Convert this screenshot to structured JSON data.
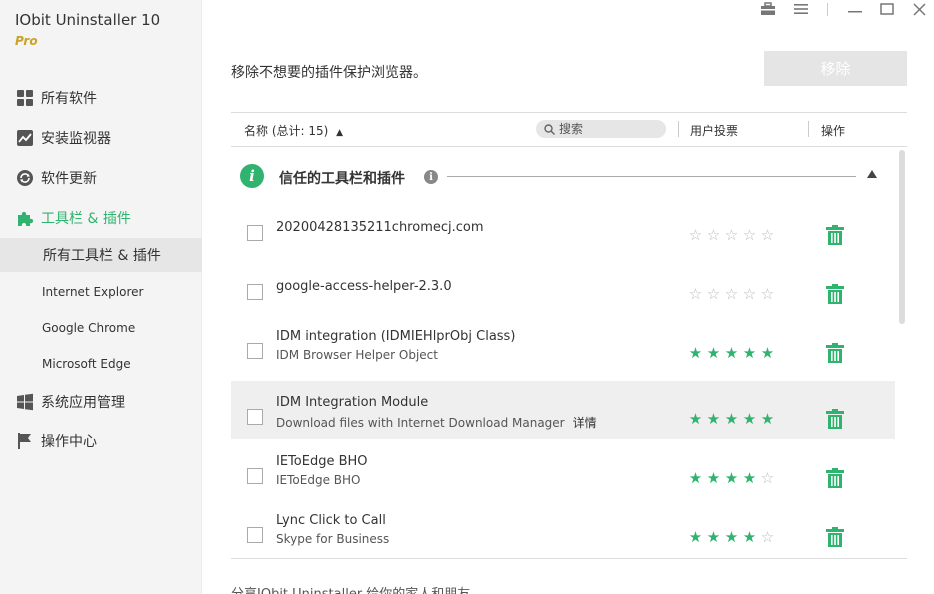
{
  "app": {
    "title": "IObit Uninstaller 10",
    "edition": "Pro"
  },
  "sidebar": {
    "items": [
      {
        "label": "所有软件",
        "icon": "grid-icon"
      },
      {
        "label": "安装监视器",
        "icon": "chart-icon"
      },
      {
        "label": "软件更新",
        "icon": "refresh-icon"
      },
      {
        "label": "工具栏 & 插件",
        "icon": "puzzle-icon",
        "active": true
      },
      {
        "label": "系统应用管理",
        "icon": "windows-icon"
      },
      {
        "label": "操作中心",
        "icon": "flag-icon"
      }
    ],
    "subitems": [
      {
        "label": "所有工具栏 & 插件",
        "selected": true
      },
      {
        "label": "Internet Explorer"
      },
      {
        "label": "Google Chrome"
      },
      {
        "label": "Microsoft Edge"
      }
    ]
  },
  "main": {
    "headline": "移除不想要的插件保护浏览器。",
    "remove_button": "移除",
    "columns": {
      "name": "名称 (总计: 15)",
      "search_placeholder": "搜索",
      "votes": "用户投票",
      "action": "操作"
    },
    "section": {
      "title": "信任的工具栏和插件",
      "icon_letter": "i"
    },
    "rows": [
      {
        "name": "20200428135211chromecj.com",
        "desc": "",
        "rating": 0
      },
      {
        "name": "google-access-helper-2.3.0",
        "desc": "",
        "rating": 0
      },
      {
        "name": "IDM integration (IDMIEHlprObj Class)",
        "desc": "IDM Browser Helper Object",
        "rating": 5
      },
      {
        "name": "IDM Integration Module",
        "desc": "Download files with Internet Download Manager",
        "detail": "详情",
        "rating": 5,
        "highlight": true
      },
      {
        "name": "IEToEdge BHO",
        "desc": "IEToEdge BHO",
        "rating": 4
      },
      {
        "name": "Lync Click to Call",
        "desc": "Skype for Business",
        "rating": 4
      }
    ],
    "footer": "分享IObit Uninstaller 给你的家人和朋友"
  },
  "colors": {
    "accent": "#2fb36f",
    "edition": "#c9a227"
  }
}
